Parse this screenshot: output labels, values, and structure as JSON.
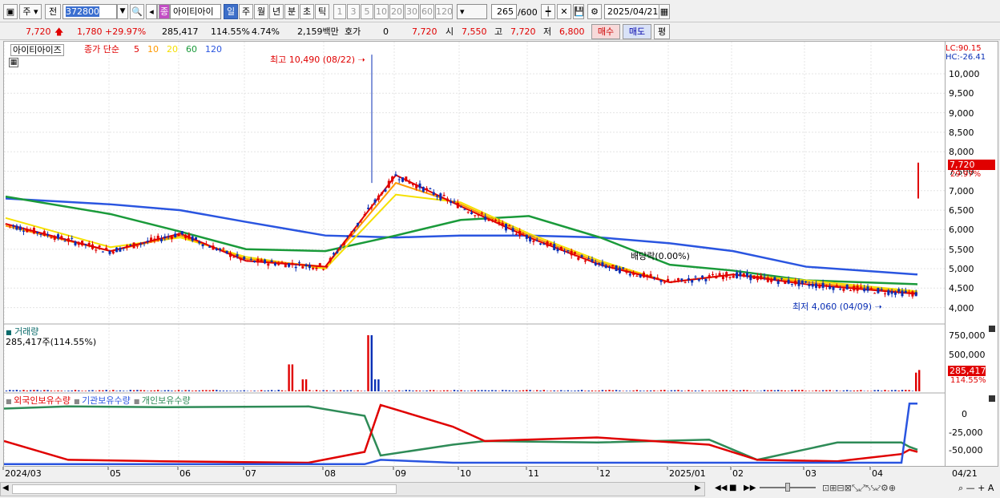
{
  "toolbar": {
    "period_unit": "주",
    "prev_label": "전",
    "stock_code": "372800",
    "stock_name": "아이티아이",
    "stock_badge": "종",
    "timeframes": [
      "일",
      "주",
      "월",
      "년",
      "분",
      "초",
      "틱"
    ],
    "active_timeframe": "일",
    "intervals": [
      "1",
      "3",
      "5",
      "10",
      "20",
      "30",
      "60",
      "120"
    ],
    "count": "265",
    "count_max": "/600",
    "date": "2025/04/21"
  },
  "info": {
    "price": "7,720",
    "change": "1,780",
    "change_pct": "+29.97%",
    "volume": "285,417",
    "volume_pct": "114.55%",
    "turnover": "4.74%",
    "amount": "2,159백만",
    "quote_label": "호가",
    "quote_value": "0",
    "ask_price": "7,720",
    "open_label": "시",
    "open": "7,550",
    "high_label": "고",
    "high": "7,720",
    "low_label": "저",
    "low": "6,800",
    "buy_label": "매수",
    "sell_label": "매도",
    "even_label": "평"
  },
  "legend": {
    "name": "아이티아이즈",
    "type": "종가 단순",
    "ma_values": [
      "5",
      "10",
      "20",
      "60",
      "120"
    ],
    "lc": "LC:90.15",
    "hc": "HC:-26.41"
  },
  "annotations": {
    "high": "최고 10,490 (08/22)",
    "low": "최저 4,060 (04/09)",
    "dividend": "배당락(0.00%)"
  },
  "price_axis": [
    "10,000",
    "9,500",
    "9,000",
    "8,500",
    "8,000",
    "7,500",
    "7,000",
    "6,500",
    "6,000",
    "5,500",
    "5,000",
    "4,500",
    "4,000"
  ],
  "price_tag": {
    "price": "7,720",
    "pct": "29.97%"
  },
  "volume_panel": {
    "title": "거래량",
    "value": "285,417주(114.55%)",
    "axis": [
      "750,000",
      "500,000",
      "250,000"
    ],
    "tag_value": "285,417",
    "tag_pct": "114.55%"
  },
  "holdings_panel": {
    "legend": [
      "외국인보유수량",
      "기관보유수량",
      "개인보유수량"
    ],
    "axis": [
      "0",
      "-25,000",
      "-50,000"
    ]
  },
  "x_axis": [
    "2024/03",
    "05",
    "06",
    "07",
    "08",
    "09",
    "10",
    "11",
    "12",
    "2025/01",
    "02",
    "03",
    "04"
  ],
  "x_axis_right": "04/21",
  "colors": {
    "up": "#e00000",
    "down": "#0a2fb5",
    "ma5": "#e00000",
    "ma10": "#ff9900",
    "ma20": "#f5e000",
    "ma60": "#1a9a3a",
    "ma120": "#2a55e0",
    "foreign": "#e00000",
    "institution": "#2a55e0",
    "individual": "#2e8b57"
  },
  "chart_data": {
    "type": "line",
    "x": [
      "2024/03",
      "05",
      "06",
      "07",
      "08",
      "09",
      "10",
      "11",
      "12",
      "2025/01",
      "02",
      "03",
      "04"
    ],
    "series": [
      {
        "name": "5",
        "values": [
          6150,
          5450,
          5900,
          5200,
          5050,
          7400,
          6600,
          5800,
          5100,
          4650,
          4850,
          4600,
          4350
        ]
      },
      {
        "name": "10",
        "values": [
          6100,
          5450,
          5850,
          5250,
          5050,
          7200,
          6650,
          5850,
          5150,
          4650,
          4850,
          4650,
          4380
        ]
      },
      {
        "name": "20",
        "values": [
          6300,
          5550,
          5800,
          5300,
          5000,
          6900,
          6700,
          5900,
          5200,
          4650,
          4850,
          4700,
          4420
        ]
      },
      {
        "name": "60",
        "values": [
          6850,
          6400,
          5950,
          5500,
          5450,
          5850,
          6250,
          6350,
          5800,
          5100,
          4950,
          4700,
          4600
        ]
      },
      {
        "name": "120",
        "values": [
          6800,
          6650,
          6500,
          6200,
          5850,
          5800,
          5850,
          5850,
          5800,
          5650,
          5450,
          5050,
          4850
        ]
      }
    ],
    "annotations": [
      {
        "label": "최고 10,490 (08/22)",
        "value": 10490
      },
      {
        "label": "최저 4,060 (04/09)",
        "value": 4060
      }
    ],
    "ylim": [
      3800,
      10500
    ]
  },
  "bottom": {
    "scroll_left": "◀",
    "scroll_right": "▶",
    "controls": [
      "◀◀",
      "■",
      "▶▶"
    ]
  }
}
